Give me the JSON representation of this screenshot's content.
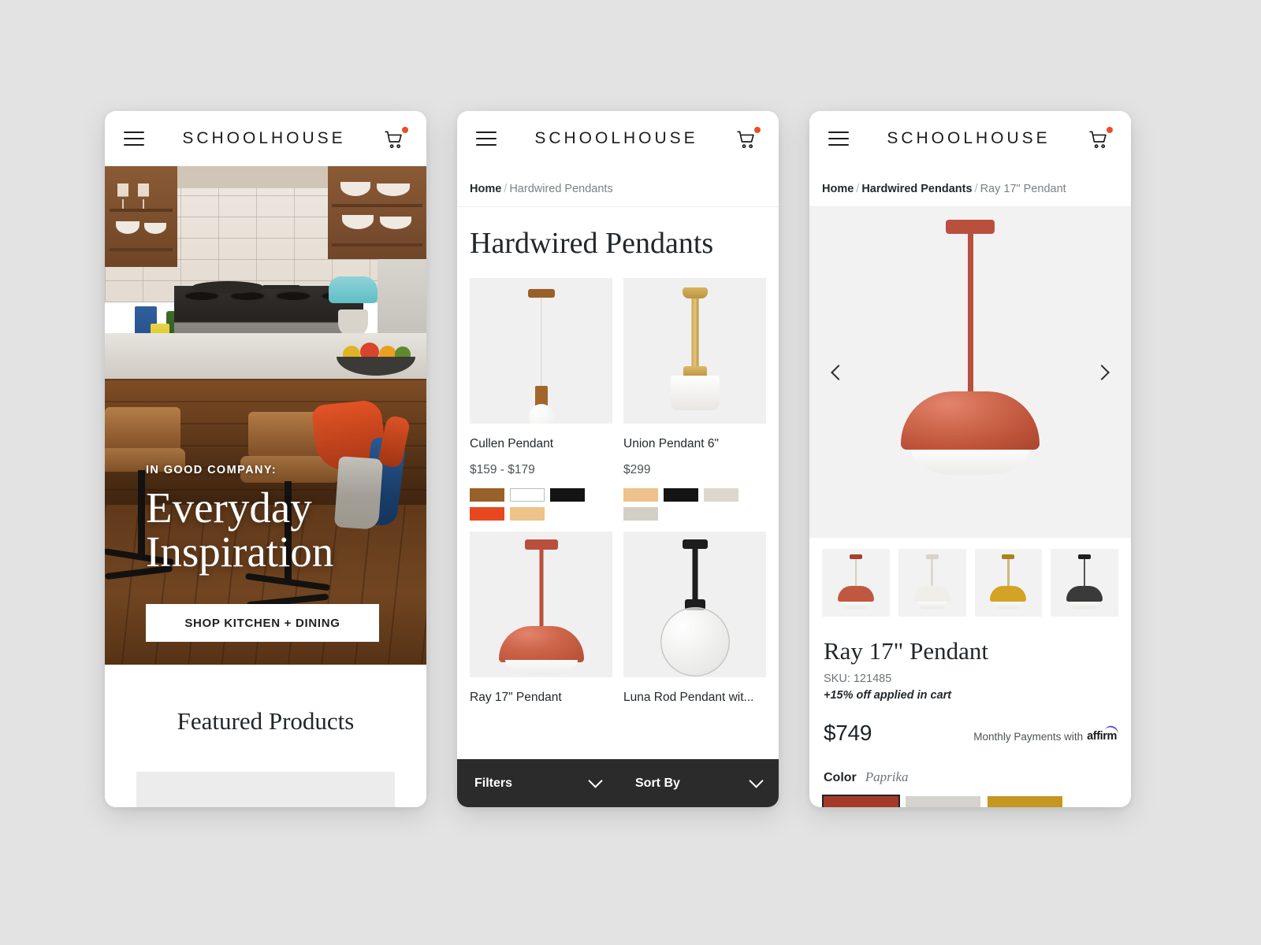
{
  "brand": "SCHOOLHOUSE",
  "icons": {
    "menu": "hamburger-menu-icon",
    "cart": "shopping-cart-icon",
    "chevron": "chevron-down-icon",
    "prev": "chevron-left-icon",
    "next": "chevron-right-icon"
  },
  "colors": {
    "cart_badge": "#e8502a",
    "filter_bar_bg": "#2b2b2b",
    "paprika": "#a33a29",
    "affirm_blue": "#4a4af4",
    "page_bg": "#e3e3e3"
  },
  "home": {
    "hero": {
      "eyebrow": "IN GOOD COMPANY:",
      "headline_line1": "Everyday",
      "headline_line2": "Inspiration",
      "cta_label": "SHOP KITCHEN + DINING"
    },
    "featured": {
      "title": "Featured Products"
    }
  },
  "plp": {
    "breadcrumb": {
      "home": "Home",
      "sep": "/",
      "current": "Hardwired Pendants"
    },
    "title": "Hardwired Pendants",
    "products": [
      {
        "name": "Cullen Pendant",
        "price": "$159 - $179",
        "swatches": [
          "#9a6029",
          "#ffffff",
          "#141414",
          "#e8481f",
          "#edc389"
        ]
      },
      {
        "name": "Union Pendant 6\"",
        "price": "$299",
        "swatches": [
          "#eec28a",
          "#141414",
          "#ddd7cd",
          "#d4cfc6"
        ]
      },
      {
        "name": "Ray 17\" Pendant",
        "price": "",
        "swatches": []
      },
      {
        "name": "Luna Rod Pendant wit...",
        "price": "",
        "swatches": []
      }
    ],
    "toolbar": {
      "filters_label": "Filters",
      "sort_label": "Sort By"
    }
  },
  "pdp": {
    "breadcrumb": {
      "home": "Home",
      "category": "Hardwired Pendants",
      "current": "Ray 17\" Pendant",
      "sep": "/"
    },
    "gallery": {
      "prev_label": "Previous image",
      "next_label": "Next image",
      "thumbnails": [
        {
          "name": "Paprika",
          "shade": "#c05840",
          "rod": "#d8cec4",
          "canopy": "#a8402c"
        },
        {
          "name": "White",
          "shade": "#f0eee9",
          "rod": "#ddd9d2",
          "canopy": "#d7d2ca"
        },
        {
          "name": "Ochre",
          "shade": "#d4a326",
          "rod": "#cdb87e",
          "canopy": "#a8821c"
        },
        {
          "name": "Black",
          "shade": "#3a3a3a",
          "rod": "#555555",
          "canopy": "#1e1e1e"
        }
      ]
    },
    "title": "Ray 17\" Pendant",
    "sku": "SKU: 121485",
    "promo": "+15% off applied in cart",
    "price": "$749",
    "financing_text": "Monthly Payments with",
    "financing_brand": "affirm",
    "color_label": "Color",
    "color_value": "Paprika",
    "color_swatches": [
      {
        "name": "Paprika",
        "hex": "#a33a29",
        "selected": true
      },
      {
        "name": "Bone",
        "hex": "#d5d3ce",
        "selected": false
      },
      {
        "name": "Ochre",
        "hex": "#c69620",
        "selected": false
      }
    ]
  }
}
